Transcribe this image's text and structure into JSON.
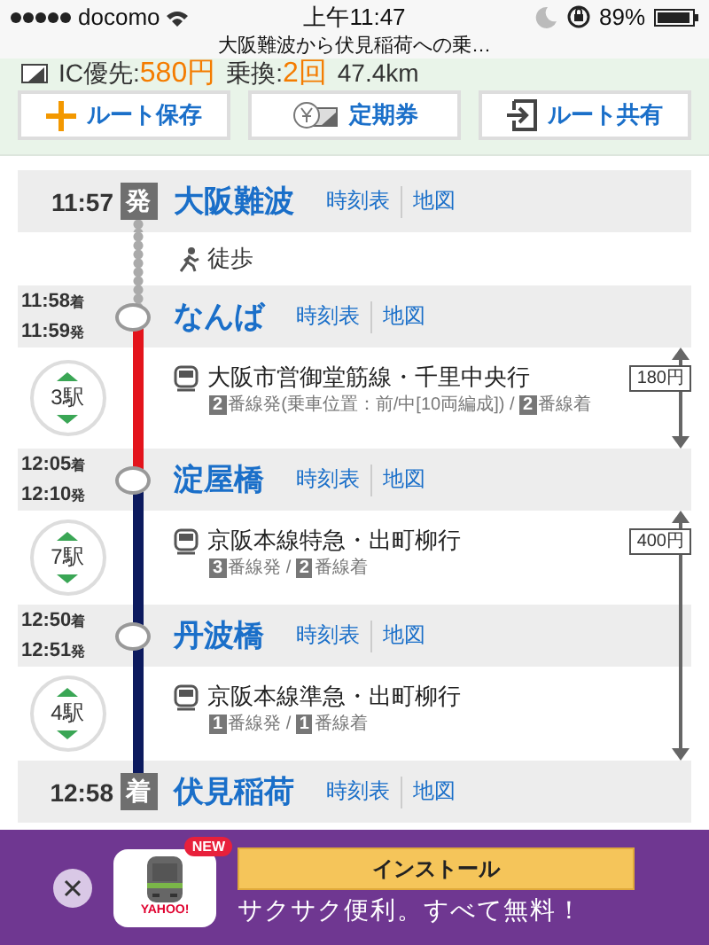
{
  "status_bar": {
    "carrier": "docomo",
    "time": "上午11:47",
    "battery": "89%"
  },
  "page_title": "大阪難波から伏見稲荷への乗…",
  "summary": {
    "ic_label": "IC優先:",
    "fare": "580円",
    "transfers_label": "乗換:",
    "transfers": "2回",
    "distance": "47.4km"
  },
  "actions": [
    {
      "kind": "plus",
      "label": "ルート保存"
    },
    {
      "kind": "pass",
      "label": "定期券"
    },
    {
      "kind": "share",
      "label": "ルート共有"
    }
  ],
  "route": [
    {
      "kind": "station",
      "time": "11:57",
      "badge": "発",
      "name": "大阪難波",
      "links": [
        "時刻表",
        "地図"
      ]
    },
    {
      "kind": "walk",
      "label": "徒歩"
    },
    {
      "kind": "station",
      "arrival": "11:58",
      "arrival_mark": "着",
      "departure": "11:59",
      "departure_mark": "発",
      "name": "なんば",
      "links": [
        "時刻表",
        "地図"
      ]
    },
    {
      "kind": "ride",
      "stops": "3駅",
      "line": "大阪市営御堂筋線・千里中央行",
      "color": "#e3141c",
      "fare": "180円",
      "platforms": [
        {
          "num": "2",
          "text": "番線発(乗車位置：前/中[10両編成]) /"
        },
        {
          "num": "2",
          "text": "番線着"
        }
      ]
    },
    {
      "kind": "station",
      "arrival": "12:05",
      "arrival_mark": "着",
      "departure": "12:10",
      "departure_mark": "発",
      "name": "淀屋橋",
      "links": [
        "時刻表",
        "地図"
      ]
    },
    {
      "kind": "ride",
      "stops": "7駅",
      "line": "京阪本線特急・出町柳行",
      "color": "#0c1a5e",
      "fare": "400円",
      "platforms": [
        {
          "num": "3",
          "text": "番線発 /"
        },
        {
          "num": "2",
          "text": "番線着"
        }
      ]
    },
    {
      "kind": "station",
      "arrival": "12:50",
      "arrival_mark": "着",
      "departure": "12:51",
      "departure_mark": "発",
      "name": "丹波橋",
      "links": [
        "時刻表",
        "地図"
      ]
    },
    {
      "kind": "ride",
      "stops": "4駅",
      "line": "京阪本線準急・出町柳行",
      "color": "#0c1a5e",
      "platforms": [
        {
          "num": "1",
          "text": "番線発 /"
        },
        {
          "num": "1",
          "text": "番線着"
        }
      ]
    },
    {
      "kind": "station",
      "time": "12:58",
      "badge": "着",
      "name": "伏見稲荷",
      "links": [
        "時刻表",
        "地図"
      ]
    }
  ],
  "ad": {
    "badge": "NEW",
    "logo": "YAHOO!",
    "button": "インストール",
    "tagline": "サクサク便利。すべて無料！"
  }
}
